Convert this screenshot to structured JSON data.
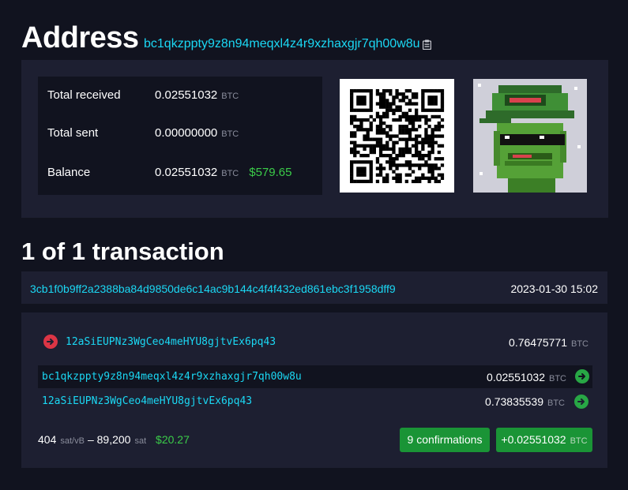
{
  "header": {
    "title": "Address",
    "address": "bc1qkzppty9z8n94meqxl4z4r9xzhaxgjr7qh00w8u"
  },
  "stats": {
    "total_received_label": "Total received",
    "total_received_value": "0.02551032",
    "total_sent_label": "Total sent",
    "total_sent_value": "0.00000000",
    "balance_label": "Balance",
    "balance_value": "0.02551032",
    "balance_fiat": "$579.65",
    "unit": "BTC"
  },
  "transactions_title": "1 of 1 transaction",
  "transaction": {
    "txid": "3cb1f0b9ff2a2388ba84d9850de6c14ac9b144c4f4f432ed861ebc3f1958dff9",
    "date": "2023-01-30 15:02",
    "input": {
      "address": "12aSiEUPNz3WgCeo4meHYU8gjtvEx6pq43",
      "amount": "0.76475771"
    },
    "outputs": [
      {
        "address": "bc1qkzppty9z8n94meqxl4z4r9xzhaxgjr7qh00w8u",
        "amount": "0.02551032"
      },
      {
        "address": "12aSiEUPNz3WgCeo4meHYU8gjtvEx6pq43",
        "amount": "0.73835539"
      }
    ],
    "fee_rate": "404",
    "fee_rate_unit": "sat/vB",
    "separator": "–",
    "fee": "89,200",
    "fee_unit": "sat",
    "fee_fiat": "$20.27",
    "confirmations": "9 confirmations",
    "net_amount": "+0.02551032",
    "unit": "BTC"
  },
  "colors": {
    "accent": "#1bd8f4",
    "positive": "#3bcc49",
    "button_green": "#1a9436",
    "input_red": "#dc3545",
    "panel": "#1d1f31",
    "background": "#11131f"
  },
  "icons": {
    "copy": "clipboard-icon",
    "input": "arrow-right-circle-red-icon",
    "output": "arrow-right-circle-green-icon"
  }
}
